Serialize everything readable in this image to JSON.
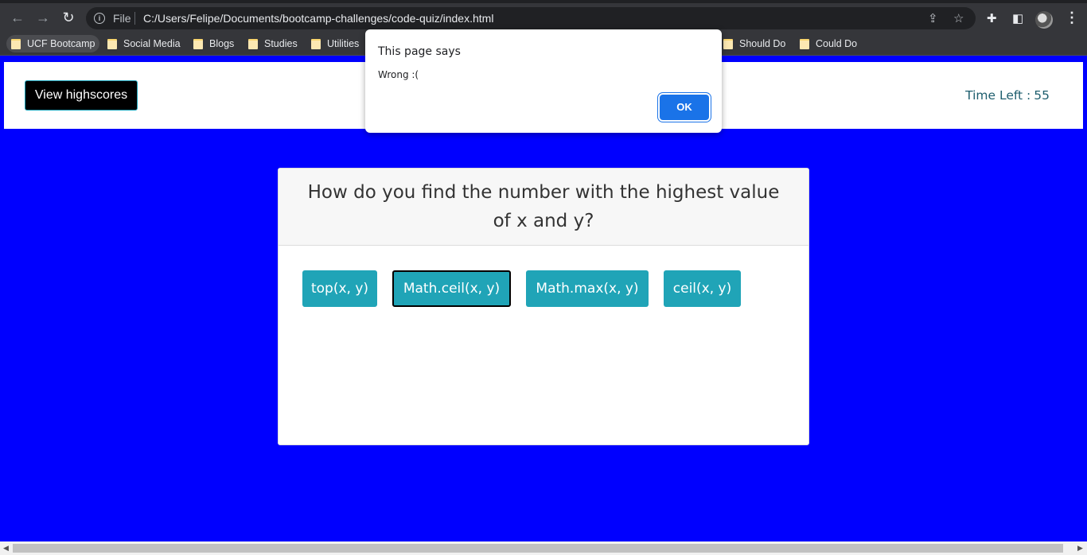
{
  "browser": {
    "scheme_label": "File",
    "url": "C:/Users/Felipe/Documents/bootcamp-challenges/code-quiz/index.html",
    "icons": [
      "back-icon",
      "forward-icon",
      "reload-icon",
      "info-icon",
      "share-icon",
      "star-icon",
      "extensions-icon",
      "side-panel-icon",
      "avatar",
      "menu-icon"
    ]
  },
  "bookmarks": [
    {
      "label": "UCF Bootcamp"
    },
    {
      "label": "Social Media"
    },
    {
      "label": "Blogs"
    },
    {
      "label": "Studies"
    },
    {
      "label": "Utilities"
    },
    {
      "label": "Should Do"
    },
    {
      "label": "Could Do"
    }
  ],
  "header": {
    "highscores_label": "View highscores",
    "timer_label": "Time Left :",
    "timer_value": "55"
  },
  "quiz": {
    "question": "How do you find the number with the highest value of x and y?",
    "answers": [
      "top(x, y)",
      "Math.ceil(x, y)",
      "Math.max(x, y)",
      "ceil(x, y)"
    ],
    "focused_answer": 1
  },
  "dialog": {
    "title": "This page says",
    "message": "Wrong :(",
    "ok_label": "OK"
  },
  "colors": {
    "page_background": "#0000ff",
    "answer_button": "#20a4b7",
    "dialog_ok": "#1a73e8"
  }
}
